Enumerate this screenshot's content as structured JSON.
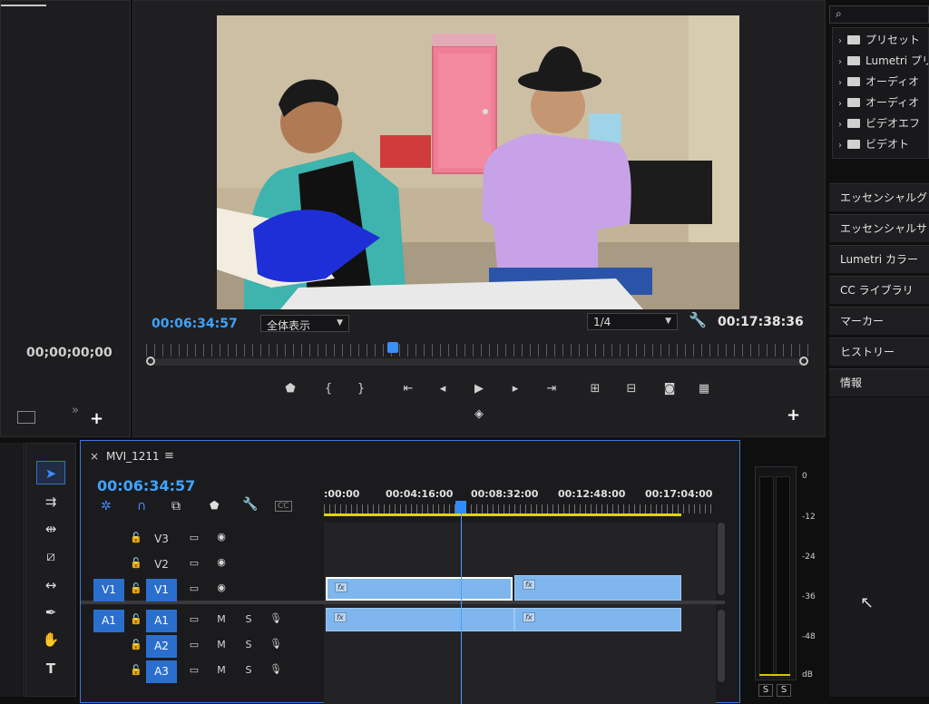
{
  "source_panel": {
    "timecode": "00;00;00;00"
  },
  "program_monitor": {
    "current_time": "00:06:34:57",
    "zoom_select": "全体表示",
    "resolution_select": "1/4",
    "duration": "00:17:38:36"
  },
  "effects_panel": {
    "search_placeholder": "",
    "tree": [
      {
        "label": "プリセット"
      },
      {
        "label": "Lumetri プリ"
      },
      {
        "label": "オーディオ"
      },
      {
        "label": "オーディオ"
      },
      {
        "label": "ビデオエフ"
      },
      {
        "label": "ビデオト"
      }
    ]
  },
  "side_panels": [
    {
      "label": "エッセンシャルグ"
    },
    {
      "label": "エッセンシャルサ"
    },
    {
      "label": "Lumetri カラー"
    },
    {
      "label": "CC ライブラリ"
    },
    {
      "label": "マーカー"
    },
    {
      "label": "ヒストリー"
    },
    {
      "label": "情報"
    }
  ],
  "timeline": {
    "sequence_name": "MVI_1211",
    "close_glyph": "×",
    "menu_glyph": "≡",
    "current_time": "00:06:34:57",
    "ruler_labels": [
      ":00:00",
      "00:04:16:00",
      "00:08:32:00",
      "00:12:48:00",
      "00:17:04:00"
    ],
    "playhead_fraction": 0.35,
    "video_tracks": [
      {
        "name": "V3",
        "target": ""
      },
      {
        "name": "V2",
        "target": ""
      },
      {
        "name": "V1",
        "target": "V1"
      }
    ],
    "audio_tracks": [
      {
        "name": "A1",
        "target": "A1",
        "m": "M",
        "s": "S"
      },
      {
        "name": "A2",
        "target": "",
        "m": "M",
        "s": "S"
      },
      {
        "name": "A3",
        "target": "",
        "m": "M",
        "s": "S"
      }
    ],
    "clip_fx_label": "fx"
  },
  "audio_meter": {
    "scale": [
      "0",
      "-12",
      "-24",
      "-36",
      "-48",
      "dB"
    ],
    "solo_labels": [
      "S",
      "S"
    ]
  },
  "colors": {
    "accent": "#3ea4ff",
    "clip": "#7fb6ee",
    "target_blue": "#2b6fce",
    "work_area": "#e2d400"
  }
}
